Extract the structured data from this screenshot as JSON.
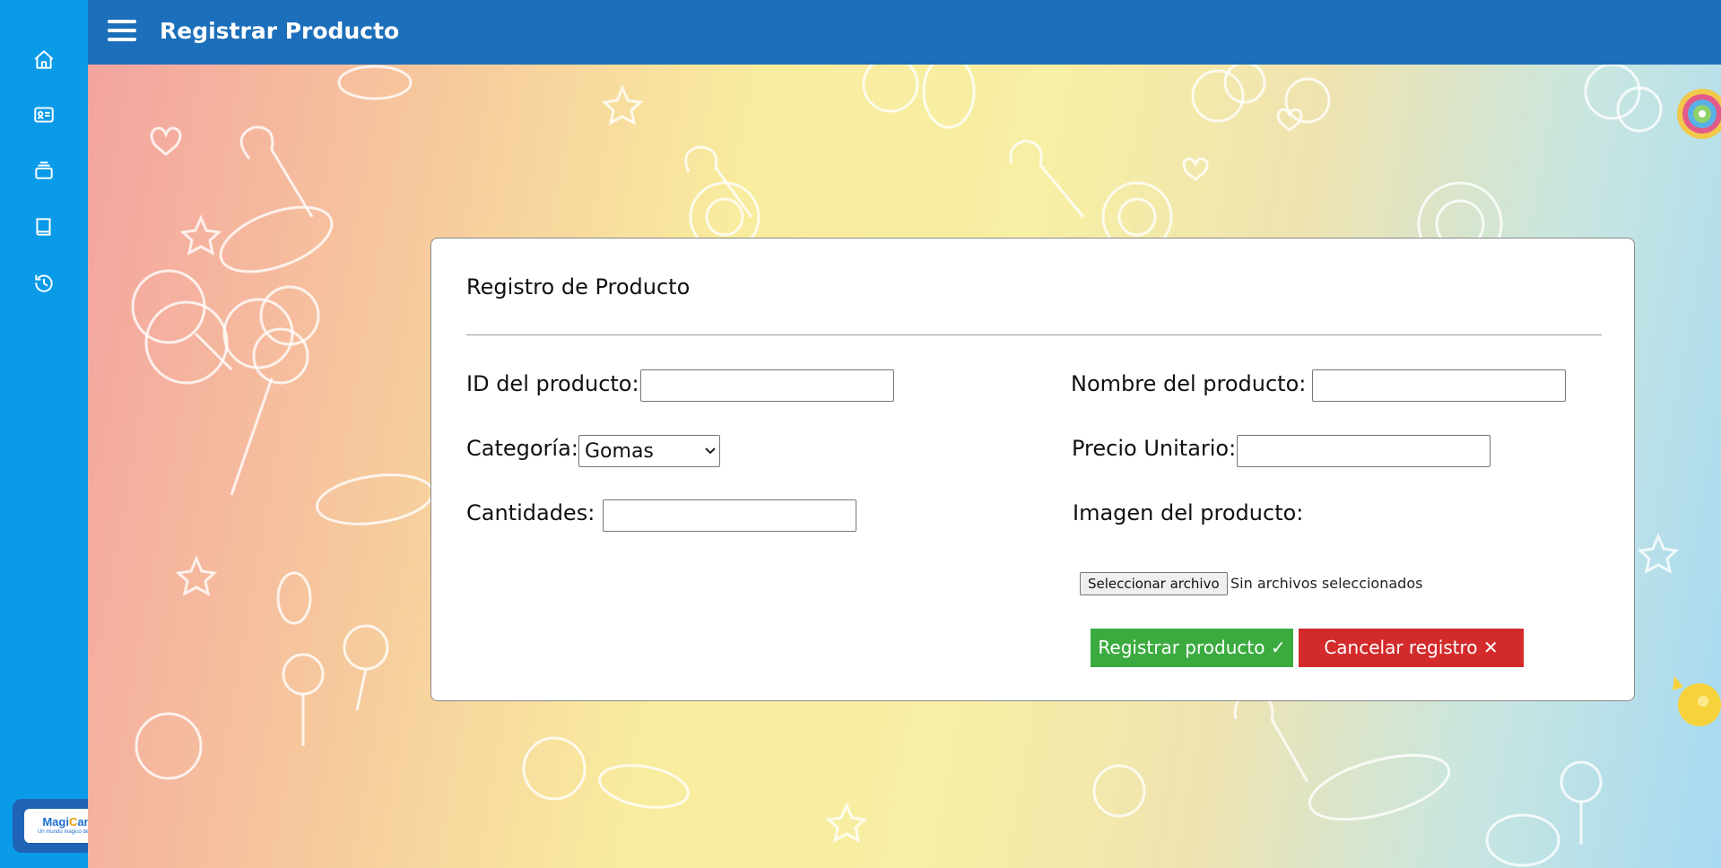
{
  "header": {
    "title": "Registrar Producto"
  },
  "sidebar": {
    "items": [
      {
        "icon": "home-icon"
      },
      {
        "icon": "id-card-icon"
      },
      {
        "icon": "stack-icon"
      },
      {
        "icon": "book-icon"
      },
      {
        "icon": "history-icon"
      }
    ]
  },
  "brand": {
    "name_part1": "Magi",
    "name_part2": "C",
    "name_part3": "andy",
    "tagline": "Un mundo mágico de sabores"
  },
  "form": {
    "title": "Registro de Producto",
    "id_label": "ID del producto:",
    "id_value": "",
    "name_label": "Nombre del producto:",
    "name_value": "",
    "category_label": "Categoría:",
    "category_value": "Gomas",
    "price_label": "Precio Unitario:",
    "price_value": "",
    "quantity_label": "Cantidades:",
    "quantity_value": "",
    "image_label": "Imagen del producto:",
    "file_button": "Seleccionar archivo",
    "file_status": "Sin archivos seleccionados",
    "register_button": "Registrar producto ✓",
    "cancel_button": "Cancelar registro ✕"
  },
  "colors": {
    "sidebar": "#0a9be8",
    "header": "#1c6fba",
    "register": "#3bab3f",
    "cancel": "#d32b2b"
  }
}
